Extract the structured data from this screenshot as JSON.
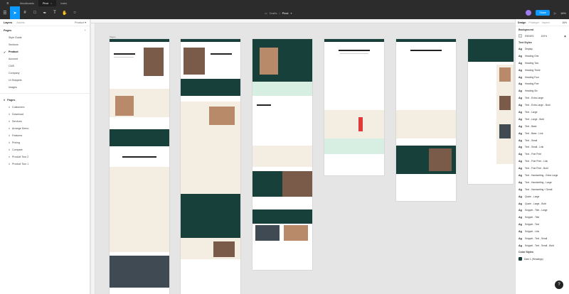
{
  "tabs": [
    {
      "label": "Moodboards",
      "active": false
    },
    {
      "label": "Pivot",
      "active": true
    },
    {
      "label": "Index",
      "active": false
    }
  ],
  "toolbar": {
    "breadcrumb_team": "Drafts",
    "breadcrumb_sep": "/",
    "project_name": "Pivot",
    "share_label": "Share",
    "zoom": "16%"
  },
  "left_panel": {
    "tab_layers": "Layers",
    "tab_assets": "Assets",
    "page_selector": "Product",
    "pages_title": "Pages",
    "pages": [
      {
        "label": "Style Guide",
        "current": false
      },
      {
        "label": "Sections",
        "current": false
      },
      {
        "label": "Product",
        "current": true
      },
      {
        "label": "Account",
        "current": false
      },
      {
        "label": "CMS",
        "current": false
      },
      {
        "label": "Company",
        "current": false
      },
      {
        "label": "UI Snippets",
        "current": false
      },
      {
        "label": "Images",
        "current": false
      }
    ],
    "layers_title": "Pages",
    "layers": [
      "Customers",
      "Download",
      "Services",
      "Arrange Demo",
      "Features",
      "Pricing",
      "Compare",
      "Product Tour 2",
      "Product Tour 1"
    ]
  },
  "canvas": {
    "frame_label": "Pages"
  },
  "right_panel": {
    "tab_design": "Design",
    "tab_prototype": "Prototype",
    "tab_inspect": "Inspect",
    "zoom": "16%",
    "background_title": "Background",
    "background_hex": "E5E5E5",
    "background_opacity": "100%",
    "text_styles_title": "Text Styles",
    "text_styles": [
      "Display",
      "Heading One",
      "Heading Two",
      "Heading Three",
      "Heading Four",
      "Heading Five",
      "Heading Six",
      "Text - Extra Large",
      "Text - Extra Large - Bold",
      "Text - Large",
      "Text - Large - Bold",
      "Text - Base",
      "Text - Base - Link",
      "Text - Small",
      "Text - Small - Link",
      "Text - Fine Print",
      "Text - Fine Print - Link",
      "Text - Fine Print - Bold",
      "Text - Handwriting - Extra Large",
      "Text - Handwriting - Large",
      "Text - Handwriting + Small",
      "Quote - Large",
      "Quote - Large - Bold",
      "Snippet - Title - Large",
      "Snippet - Title",
      "Snippet - Text",
      "Snippet - Link",
      "Snippet - Text - Small",
      "Snippet - Text - Small - Bold"
    ],
    "color_styles_title": "Color Styles",
    "color_styles": [
      "Dark 1 (Headings)"
    ]
  },
  "colors": {
    "accent": "#0d99ff",
    "brand_dark_green": "#18403b",
    "canvas_bg": "#e5e5e5"
  },
  "help_label": "?"
}
